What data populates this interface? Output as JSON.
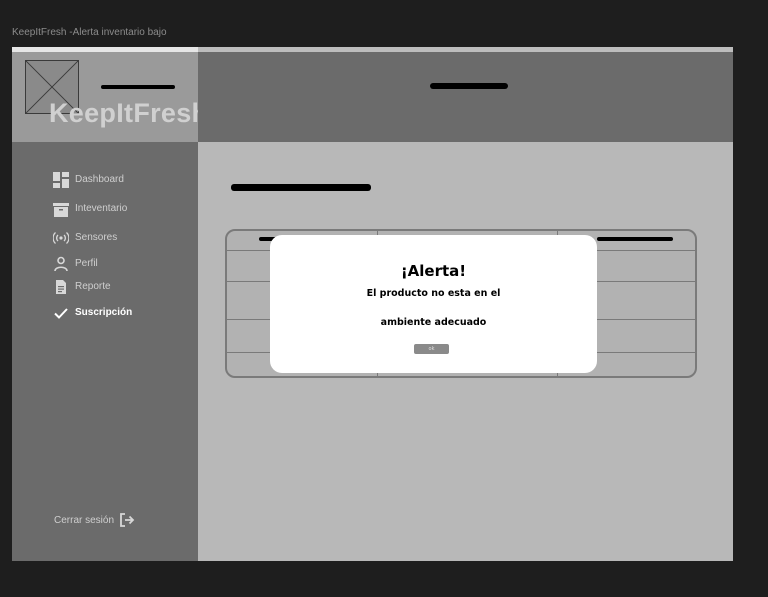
{
  "frame_title": "KeepItFresh -Alerta inventario bajo",
  "logo": {
    "text": "KeepItFresh"
  },
  "sidebar": {
    "items": [
      {
        "label": "Dashboard",
        "icon": "dashboard-icon"
      },
      {
        "label": "Inteventario",
        "icon": "inventory-box-icon"
      },
      {
        "label": "Sensores",
        "icon": "sensor-waves-icon"
      },
      {
        "label": "Perfil",
        "icon": "person-icon"
      },
      {
        "label": "Reporte",
        "icon": "document-icon"
      },
      {
        "label": "Suscripción",
        "icon": "checkmark-icon"
      }
    ],
    "logout": {
      "label": "Cerrar sesión",
      "icon": "logout-icon"
    }
  },
  "modal": {
    "title": "¡Alerta!",
    "message_line1": "El producto no esta en el",
    "message_line2": "ambiente adecuado",
    "ok_label": "ok"
  },
  "colors": {
    "background": "#1e1e1e",
    "sidebar": "#6b6b6b",
    "header": "#6b6b6b",
    "content": "#b8b8b8",
    "modal": "#ffffff",
    "button": "#8a8a8a"
  }
}
